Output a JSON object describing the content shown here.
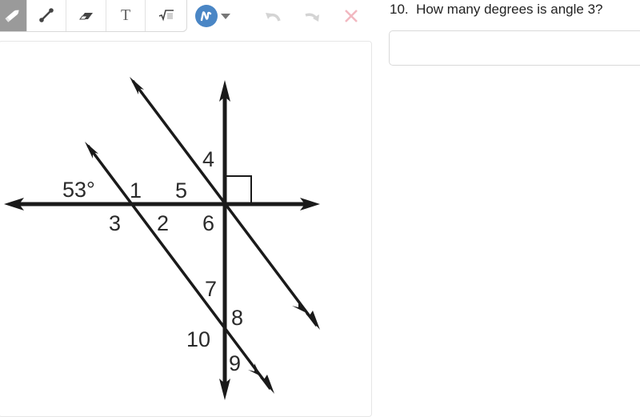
{
  "toolbar": {
    "tools": [
      {
        "name": "pencil",
        "icon": "pencil-icon",
        "active": true
      },
      {
        "name": "line",
        "icon": "line-segment-icon",
        "active": false
      },
      {
        "name": "eraser",
        "icon": "eraser-icon",
        "active": false
      },
      {
        "name": "text",
        "icon": "text-icon",
        "label": "T",
        "active": false
      },
      {
        "name": "math",
        "icon": "square-root-icon",
        "active": false
      }
    ],
    "color_picker": {
      "icon": "scribble-icon",
      "color": "#4a86c5"
    },
    "undo_icon": "undo-icon",
    "redo_icon": "redo-icon",
    "clear_icon": "close-icon",
    "clear_color": "#f2b8c0"
  },
  "question": {
    "number": "10.",
    "text": "10.  How many degrees is angle 3?"
  },
  "answer": {
    "value": "",
    "placeholder": ""
  },
  "diagram": {
    "given_angle": "53°",
    "angle_labels": [
      "1",
      "2",
      "3",
      "4",
      "5",
      "6",
      "7",
      "8",
      "9",
      "10"
    ],
    "right_angle_marker": true
  }
}
